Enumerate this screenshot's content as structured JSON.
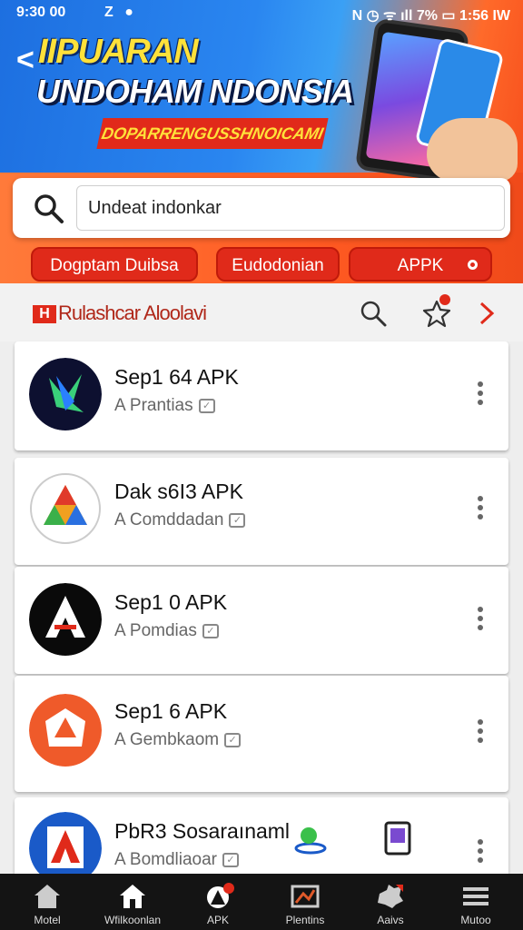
{
  "status_bar": {
    "time": "9:30 00",
    "icons_left": "Z ● ",
    "right": "N ◷ ᯤ ıll 7% ▭ 1:56 IW"
  },
  "hero": {
    "back_label": "<",
    "line1": "IIPUARAN",
    "line2": "UNDOHAM NDONSIA",
    "line3": "DOPARRENGUSSHNOICAMI"
  },
  "search": {
    "value": "Undeat indonkar"
  },
  "chips": [
    {
      "label": "Dogptam Duibsa"
    },
    {
      "label": "Eudodonian"
    },
    {
      "label": "APPK"
    }
  ],
  "section": {
    "logo": "H",
    "title": "Rulashcar Aloolavi"
  },
  "apps": [
    {
      "name": "Sep1 64 APK",
      "sub": "A Prantias",
      "color": "#0d1030"
    },
    {
      "name": "Dak s6I3 APK",
      "sub": "A Comddadan",
      "color": "#ffffff"
    },
    {
      "name": "Sep1 0 APK",
      "sub": "A Pomdias",
      "color": "#0a0a0a"
    },
    {
      "name": "Sep1 6 APK",
      "sub": "A Gembkaom",
      "color": "#ef5a2a"
    },
    {
      "name": "PbR3 Sosaraınaml",
      "sub": "A Bomdliaoar",
      "color": "#1a5ac8"
    }
  ],
  "nav": [
    {
      "label": "Motel",
      "icon": "home-icon"
    },
    {
      "label": "Wfilkoonlan",
      "icon": "house-icon"
    },
    {
      "label": "APK",
      "icon": "apk-icon"
    },
    {
      "label": "Plentins",
      "icon": "image-icon"
    },
    {
      "label": "Aaivs",
      "icon": "puzzle-icon"
    },
    {
      "label": "Mutoo",
      "icon": "menu-icon"
    }
  ],
  "colors": {
    "accent": "#e02a1a",
    "hero_blue": "#2a86f0",
    "hero_orange": "#ff5a22"
  }
}
